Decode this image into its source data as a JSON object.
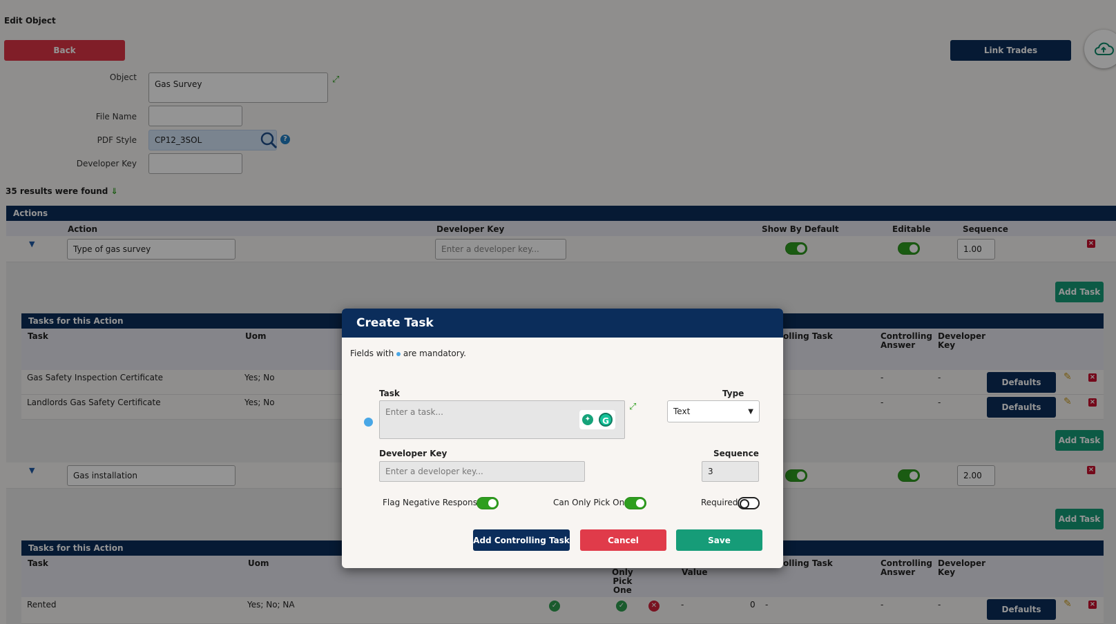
{
  "page": {
    "title": "Edit Object",
    "back_label": "Back",
    "link_trades_label": "Link Trades"
  },
  "form": {
    "object_label": "Object",
    "object_value": "Gas Survey",
    "file_name_label": "File Name",
    "file_name_value": "",
    "pdf_style_label": "PDF Style",
    "pdf_style_value": "CP12_3SOL",
    "developer_key_label": "Developer Key",
    "developer_key_value": ""
  },
  "results_text": "35 results were found",
  "actions": {
    "bar_title": "Actions",
    "columns": [
      "Action",
      "Developer Key",
      "Show By Default",
      "Editable",
      "Sequence"
    ],
    "rows": [
      {
        "action": "Type of gas survey",
        "developer_key_placeholder": "Enter a developer key...",
        "sequence": "1.00"
      },
      {
        "action": "Gas installation",
        "sequence": "2.00"
      }
    ],
    "add_task_label": "Add Task"
  },
  "tasks": {
    "bar_title": "Tasks for this Action",
    "columns": {
      "task": "Task",
      "uom": "Uom",
      "controlling_task": "olling Task",
      "controlling_answer_1": "Controlling",
      "controlling_answer_2": "Answer",
      "developer_key_1": "Developer",
      "developer_key_2": "Key",
      "only_1": "Only",
      "only_2": "Pick",
      "only_3": "One",
      "value": "Value"
    },
    "group1": [
      {
        "task": "Gas Safety Inspection Certificate",
        "uom": "Yes; No",
        "ctrl_answer": "-",
        "dev_key": "-"
      },
      {
        "task": "Landlords Gas Safety Certificate",
        "uom": "Yes; No",
        "ctrl_answer": "-",
        "dev_key": "-"
      }
    ],
    "group2": [
      {
        "task": "Rented",
        "uom": "Yes; No; NA",
        "value": "-",
        "count": "0",
        "ctrl_task": "-",
        "ctrl_answer": "-",
        "dev_key": "-"
      }
    ],
    "defaults_label": "Defaults"
  },
  "modal": {
    "title": "Create Task",
    "mandatory_prefix": "Fields with",
    "mandatory_suffix": "are mandatory.",
    "task_label": "Task",
    "task_placeholder": "Enter a task...",
    "type_label": "Type",
    "type_value": "Text",
    "dev_key_label": "Developer Key",
    "dev_key_placeholder": "Enter a developer key...",
    "sequence_label": "Sequence",
    "sequence_value": "3",
    "flag_negative_label": "Flag Negative Responses",
    "can_only_pick_one_label": "Can Only Pick One",
    "required_label": "Required",
    "add_controlling_label": "Add Controlling Task",
    "cancel_label": "Cancel",
    "save_label": "Save"
  },
  "colors": {
    "navy": "#0b2d5b",
    "red": "#dc3545",
    "green": "#169c78",
    "toggle_green": "#2e9e1f",
    "mandatory_dot": "#49a7e6"
  }
}
